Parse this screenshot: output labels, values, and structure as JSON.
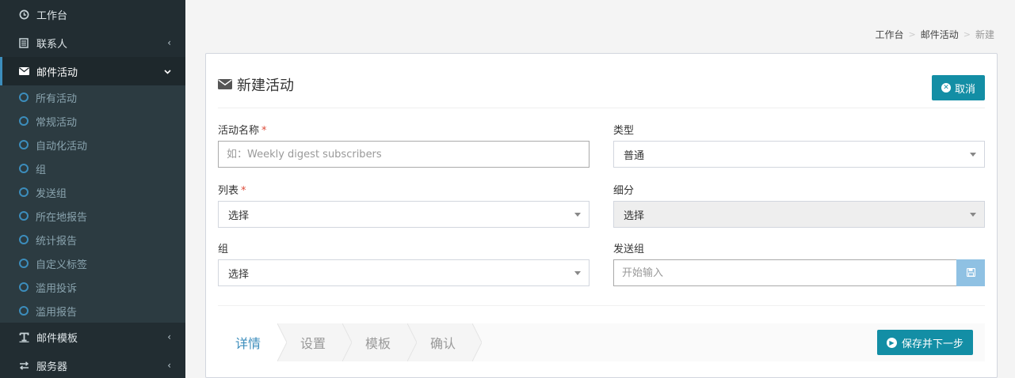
{
  "sidebar": {
    "items": [
      {
        "label": "工作台",
        "icon": "dashboard-icon"
      },
      {
        "label": "联系人",
        "icon": "address-book-icon",
        "chevron": "‹"
      },
      {
        "label": "邮件活动",
        "icon": "envelope-icon",
        "chevron": "⌄",
        "active": true
      },
      {
        "label": "邮件模板",
        "icon": "text-icon",
        "chevron": "‹"
      },
      {
        "label": "服务器",
        "icon": "exchange-icon",
        "chevron": "‹"
      }
    ],
    "subitems": [
      "所有活动",
      "常规活动",
      "自动化活动",
      "组",
      "发送组",
      "所在地报告",
      "统计报告",
      "自定义标签",
      "滥用投诉",
      "滥用报告"
    ]
  },
  "breadcrumb": {
    "items": [
      "工作台",
      "邮件活动",
      "新建"
    ],
    "sep": ">"
  },
  "box": {
    "title": "新建活动",
    "cancel_label": "取消"
  },
  "form": {
    "name": {
      "label": "活动名称",
      "required": "*",
      "placeholder": "如：Weekly digest subscribers"
    },
    "type": {
      "label": "类型",
      "value": "普通"
    },
    "list": {
      "label": "列表",
      "required": "*",
      "value": "选择"
    },
    "segment": {
      "label": "细分",
      "value": "选择"
    },
    "group": {
      "label": "组",
      "value": "选择"
    },
    "send_group": {
      "label": "发送组",
      "placeholder": "开始输入"
    }
  },
  "wizard": {
    "steps": [
      "详情",
      "设置",
      "模板",
      "确认"
    ],
    "save_next_label": "保存并下一步"
  },
  "colors": {
    "sidebar_bg": "#222d32",
    "accent": "#3c8dbc",
    "button": "#138ea5",
    "required": "#dd4b39"
  }
}
